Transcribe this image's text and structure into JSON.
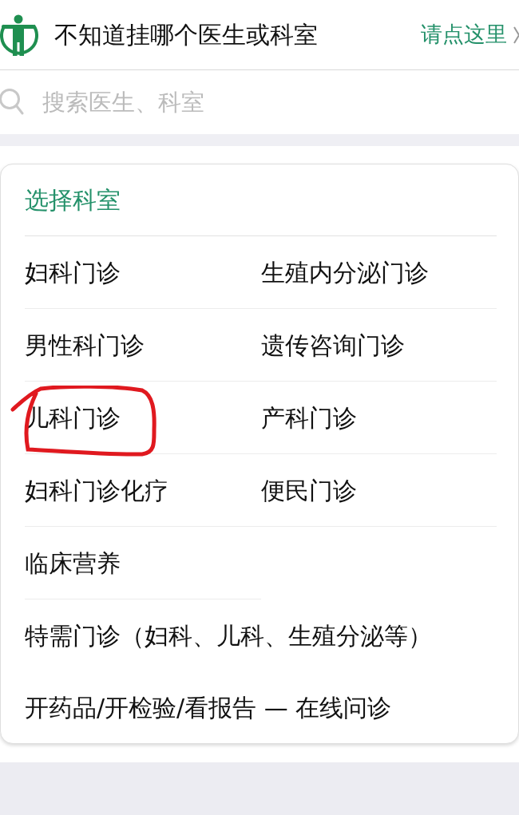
{
  "header": {
    "prompt": "不知道挂哪个医生或科室",
    "link": "请点这里"
  },
  "search": {
    "placeholder": "搜索医生、科室"
  },
  "department_panel": {
    "title": "选择科室",
    "departments": [
      {
        "label": "妇科门诊",
        "kind": "cell",
        "circled": false
      },
      {
        "label": "生殖内分泌门诊",
        "kind": "cell",
        "circled": false
      },
      {
        "label": "男性科门诊",
        "kind": "cell",
        "circled": false
      },
      {
        "label": "遗传咨询门诊",
        "kind": "cell",
        "circled": false
      },
      {
        "label": "儿科门诊",
        "kind": "cell",
        "circled": true
      },
      {
        "label": "产科门诊",
        "kind": "cell",
        "circled": false
      },
      {
        "label": "妇科门诊化疗",
        "kind": "cell",
        "circled": false
      },
      {
        "label": "便民门诊",
        "kind": "cell",
        "circled": false
      },
      {
        "label": "临床营养",
        "kind": "cell",
        "circled": false
      },
      {
        "label": "特需门诊（妇科、儿科、生殖分泌等）",
        "kind": "wide",
        "circled": false
      },
      {
        "label": "开药品/开检验/看报告 — 在线问诊",
        "kind": "wide",
        "circled": false
      }
    ]
  }
}
